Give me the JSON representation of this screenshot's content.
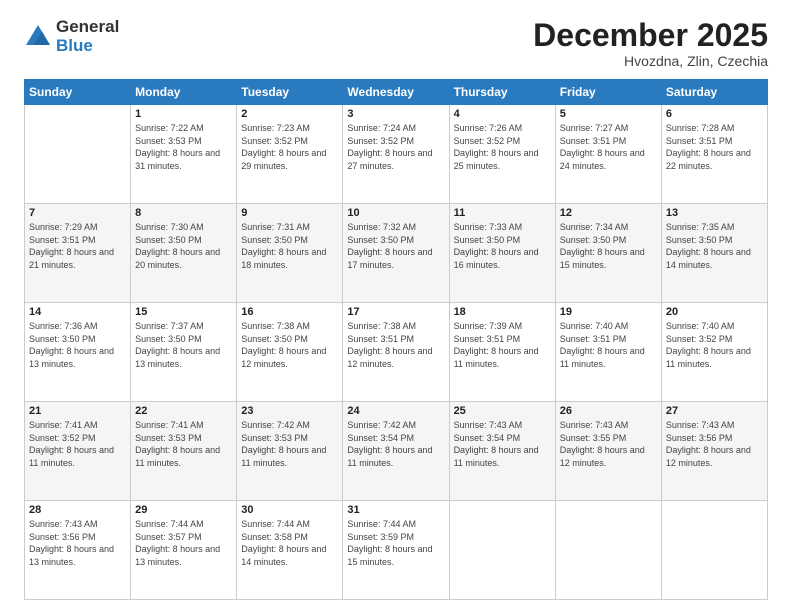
{
  "logo": {
    "general": "General",
    "blue": "Blue"
  },
  "title": "December 2025",
  "location": "Hvozdna, Zlin, Czechia",
  "days_of_week": [
    "Sunday",
    "Monday",
    "Tuesday",
    "Wednesday",
    "Thursday",
    "Friday",
    "Saturday"
  ],
  "weeks": [
    [
      {
        "num": "",
        "sunrise": "",
        "sunset": "",
        "daylight": ""
      },
      {
        "num": "1",
        "sunrise": "Sunrise: 7:22 AM",
        "sunset": "Sunset: 3:53 PM",
        "daylight": "Daylight: 8 hours and 31 minutes."
      },
      {
        "num": "2",
        "sunrise": "Sunrise: 7:23 AM",
        "sunset": "Sunset: 3:52 PM",
        "daylight": "Daylight: 8 hours and 29 minutes."
      },
      {
        "num": "3",
        "sunrise": "Sunrise: 7:24 AM",
        "sunset": "Sunset: 3:52 PM",
        "daylight": "Daylight: 8 hours and 27 minutes."
      },
      {
        "num": "4",
        "sunrise": "Sunrise: 7:26 AM",
        "sunset": "Sunset: 3:52 PM",
        "daylight": "Daylight: 8 hours and 25 minutes."
      },
      {
        "num": "5",
        "sunrise": "Sunrise: 7:27 AM",
        "sunset": "Sunset: 3:51 PM",
        "daylight": "Daylight: 8 hours and 24 minutes."
      },
      {
        "num": "6",
        "sunrise": "Sunrise: 7:28 AM",
        "sunset": "Sunset: 3:51 PM",
        "daylight": "Daylight: 8 hours and 22 minutes."
      }
    ],
    [
      {
        "num": "7",
        "sunrise": "Sunrise: 7:29 AM",
        "sunset": "Sunset: 3:51 PM",
        "daylight": "Daylight: 8 hours and 21 minutes."
      },
      {
        "num": "8",
        "sunrise": "Sunrise: 7:30 AM",
        "sunset": "Sunset: 3:50 PM",
        "daylight": "Daylight: 8 hours and 20 minutes."
      },
      {
        "num": "9",
        "sunrise": "Sunrise: 7:31 AM",
        "sunset": "Sunset: 3:50 PM",
        "daylight": "Daylight: 8 hours and 18 minutes."
      },
      {
        "num": "10",
        "sunrise": "Sunrise: 7:32 AM",
        "sunset": "Sunset: 3:50 PM",
        "daylight": "Daylight: 8 hours and 17 minutes."
      },
      {
        "num": "11",
        "sunrise": "Sunrise: 7:33 AM",
        "sunset": "Sunset: 3:50 PM",
        "daylight": "Daylight: 8 hours and 16 minutes."
      },
      {
        "num": "12",
        "sunrise": "Sunrise: 7:34 AM",
        "sunset": "Sunset: 3:50 PM",
        "daylight": "Daylight: 8 hours and 15 minutes."
      },
      {
        "num": "13",
        "sunrise": "Sunrise: 7:35 AM",
        "sunset": "Sunset: 3:50 PM",
        "daylight": "Daylight: 8 hours and 14 minutes."
      }
    ],
    [
      {
        "num": "14",
        "sunrise": "Sunrise: 7:36 AM",
        "sunset": "Sunset: 3:50 PM",
        "daylight": "Daylight: 8 hours and 13 minutes."
      },
      {
        "num": "15",
        "sunrise": "Sunrise: 7:37 AM",
        "sunset": "Sunset: 3:50 PM",
        "daylight": "Daylight: 8 hours and 13 minutes."
      },
      {
        "num": "16",
        "sunrise": "Sunrise: 7:38 AM",
        "sunset": "Sunset: 3:50 PM",
        "daylight": "Daylight: 8 hours and 12 minutes."
      },
      {
        "num": "17",
        "sunrise": "Sunrise: 7:38 AM",
        "sunset": "Sunset: 3:51 PM",
        "daylight": "Daylight: 8 hours and 12 minutes."
      },
      {
        "num": "18",
        "sunrise": "Sunrise: 7:39 AM",
        "sunset": "Sunset: 3:51 PM",
        "daylight": "Daylight: 8 hours and 11 minutes."
      },
      {
        "num": "19",
        "sunrise": "Sunrise: 7:40 AM",
        "sunset": "Sunset: 3:51 PM",
        "daylight": "Daylight: 8 hours and 11 minutes."
      },
      {
        "num": "20",
        "sunrise": "Sunrise: 7:40 AM",
        "sunset": "Sunset: 3:52 PM",
        "daylight": "Daylight: 8 hours and 11 minutes."
      }
    ],
    [
      {
        "num": "21",
        "sunrise": "Sunrise: 7:41 AM",
        "sunset": "Sunset: 3:52 PM",
        "daylight": "Daylight: 8 hours and 11 minutes."
      },
      {
        "num": "22",
        "sunrise": "Sunrise: 7:41 AM",
        "sunset": "Sunset: 3:53 PM",
        "daylight": "Daylight: 8 hours and 11 minutes."
      },
      {
        "num": "23",
        "sunrise": "Sunrise: 7:42 AM",
        "sunset": "Sunset: 3:53 PM",
        "daylight": "Daylight: 8 hours and 11 minutes."
      },
      {
        "num": "24",
        "sunrise": "Sunrise: 7:42 AM",
        "sunset": "Sunset: 3:54 PM",
        "daylight": "Daylight: 8 hours and 11 minutes."
      },
      {
        "num": "25",
        "sunrise": "Sunrise: 7:43 AM",
        "sunset": "Sunset: 3:54 PM",
        "daylight": "Daylight: 8 hours and 11 minutes."
      },
      {
        "num": "26",
        "sunrise": "Sunrise: 7:43 AM",
        "sunset": "Sunset: 3:55 PM",
        "daylight": "Daylight: 8 hours and 12 minutes."
      },
      {
        "num": "27",
        "sunrise": "Sunrise: 7:43 AM",
        "sunset": "Sunset: 3:56 PM",
        "daylight": "Daylight: 8 hours and 12 minutes."
      }
    ],
    [
      {
        "num": "28",
        "sunrise": "Sunrise: 7:43 AM",
        "sunset": "Sunset: 3:56 PM",
        "daylight": "Daylight: 8 hours and 13 minutes."
      },
      {
        "num": "29",
        "sunrise": "Sunrise: 7:44 AM",
        "sunset": "Sunset: 3:57 PM",
        "daylight": "Daylight: 8 hours and 13 minutes."
      },
      {
        "num": "30",
        "sunrise": "Sunrise: 7:44 AM",
        "sunset": "Sunset: 3:58 PM",
        "daylight": "Daylight: 8 hours and 14 minutes."
      },
      {
        "num": "31",
        "sunrise": "Sunrise: 7:44 AM",
        "sunset": "Sunset: 3:59 PM",
        "daylight": "Daylight: 8 hours and 15 minutes."
      },
      {
        "num": "",
        "sunrise": "",
        "sunset": "",
        "daylight": ""
      },
      {
        "num": "",
        "sunrise": "",
        "sunset": "",
        "daylight": ""
      },
      {
        "num": "",
        "sunrise": "",
        "sunset": "",
        "daylight": ""
      }
    ]
  ]
}
